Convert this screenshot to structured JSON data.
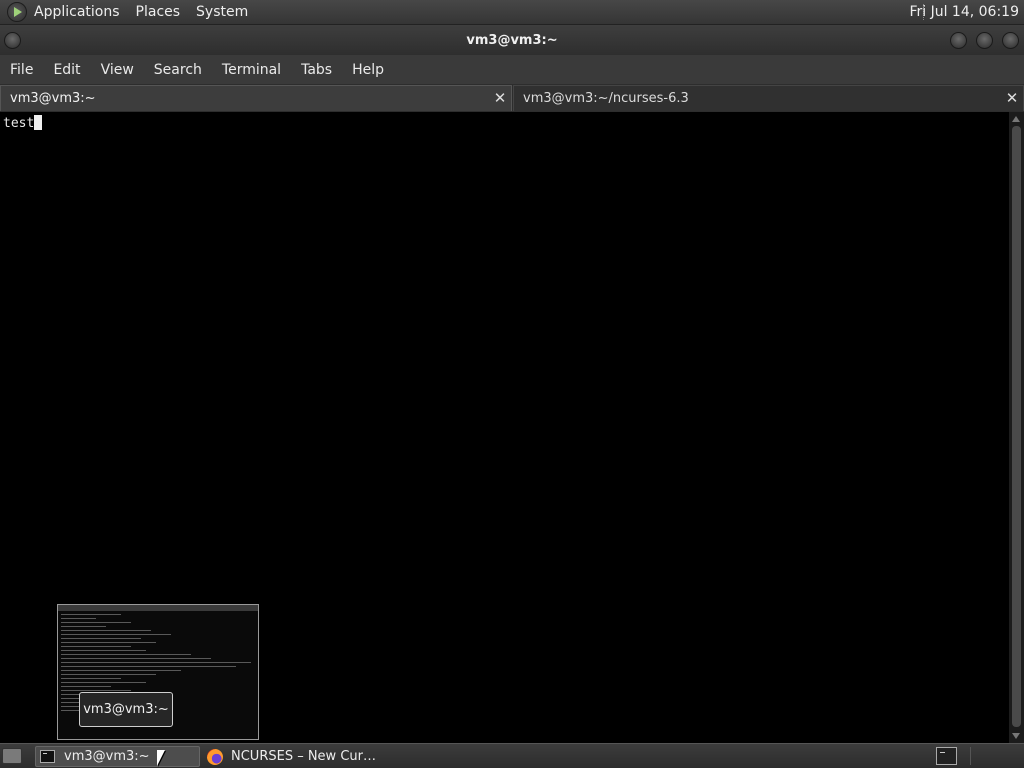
{
  "top_panel": {
    "menus": [
      "Applications",
      "Places",
      "System"
    ],
    "clock": "Fri Jul 14, 06:19",
    "logo_icon": "distro-logo-icon"
  },
  "window": {
    "title": "vm3@vm3:~"
  },
  "menubar": {
    "items": [
      "File",
      "Edit",
      "View",
      "Search",
      "Terminal",
      "Tabs",
      "Help"
    ]
  },
  "tabs": [
    {
      "label": "vm3@vm3:~",
      "active": true,
      "close": "✕"
    },
    {
      "label": "vm3@vm3:~/ncurses-6.3",
      "active": false,
      "close": "✕"
    }
  ],
  "terminal": {
    "text": "test",
    "background": "#000000",
    "foreground": "#e8e8e8"
  },
  "preview": {
    "tooltip": "vm3@vm3:~"
  },
  "taskbar": {
    "tasks": [
      {
        "label": "vm3@vm3:~",
        "icon": "terminal-icon",
        "active": true
      },
      {
        "label": "NCURSES – New Cur…",
        "icon": "firefox-icon",
        "active": false
      }
    ]
  }
}
